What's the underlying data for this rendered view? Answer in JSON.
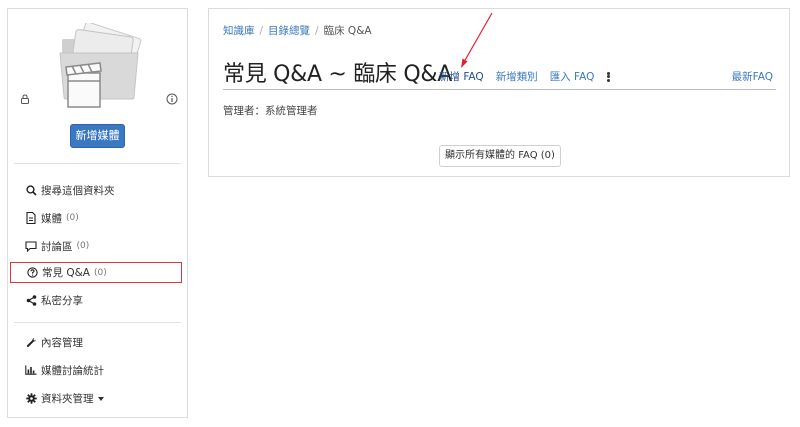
{
  "sidebar": {
    "add_media_label": "新增媒體",
    "items": [
      {
        "label": "搜尋這個資料夾",
        "count": "",
        "icon": "search-icon"
      },
      {
        "label": "媒體",
        "count": "(0)",
        "icon": "file-icon"
      },
      {
        "label": "討論區",
        "count": "(0)",
        "icon": "comment-icon"
      },
      {
        "label": "常見 Q&A",
        "count": "(0)",
        "icon": "question-circle-icon"
      },
      {
        "label": "私密分享",
        "count": "",
        "icon": "share-icon"
      },
      {
        "label": "內容管理",
        "count": "",
        "icon": "wrench-icon"
      },
      {
        "label": "媒體討論統計",
        "count": "",
        "icon": "bar-chart-icon"
      },
      {
        "label": "資料夾管理",
        "count": "",
        "icon": "gear-icon"
      }
    ],
    "active_color": "#d9363e"
  },
  "breadcrumb": {
    "items": [
      "知識庫",
      "目錄總覽",
      "臨床 Q&A"
    ],
    "separator": "/"
  },
  "main": {
    "title": "常見 Q&A ~ 臨床 Q&A",
    "actions": [
      "新增 FAQ",
      "新增類別",
      "匯入 FAQ"
    ],
    "latest_label": "最新FAQ",
    "manager_text": "管理者：系統管理者",
    "show_all_label": "顯示所有媒體的 FAQ (0)"
  },
  "colors": {
    "accent": "#3a78c1",
    "annotation_arrow": "#e0202a"
  }
}
